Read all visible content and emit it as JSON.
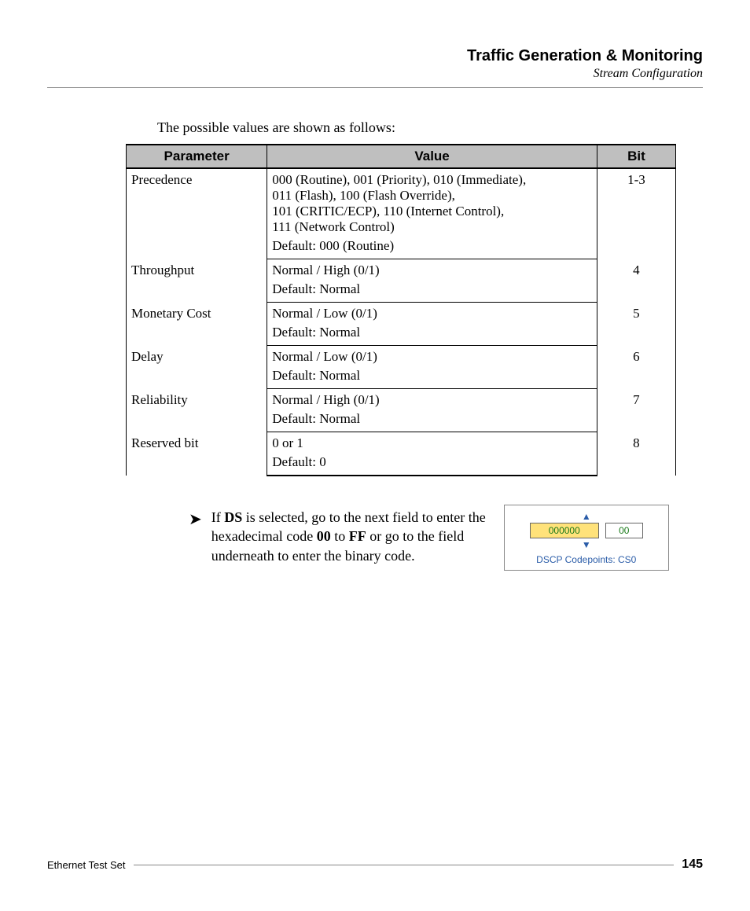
{
  "header": {
    "title": "Traffic Generation & Monitoring",
    "subtitle": "Stream Configuration"
  },
  "intro": "The possible values are shown as follows:",
  "table": {
    "headers": {
      "parameter": "Parameter",
      "value": "Value",
      "bit": "Bit"
    },
    "rows": [
      {
        "parameter": "Precedence",
        "value_lines": [
          "000 (Routine), 001 (Priority), 010 (Immediate),",
          "011 (Flash), 100 (Flash Override),",
          "101 (CRITIC/ECP), 110 (Internet Control),",
          "111 (Network Control)"
        ],
        "default": "Default: 000 (Routine)",
        "bit": "1-3"
      },
      {
        "parameter": "Throughput",
        "value_lines": [
          "Normal / High (0/1)"
        ],
        "default": "Default: Normal",
        "bit": "4"
      },
      {
        "parameter": "Monetary Cost",
        "value_lines": [
          "Normal / Low (0/1)"
        ],
        "default": "Default: Normal",
        "bit": "5"
      },
      {
        "parameter": "Delay",
        "value_lines": [
          "Normal / Low (0/1)"
        ],
        "default": "Default: Normal",
        "bit": "6"
      },
      {
        "parameter": "Reliability",
        "value_lines": [
          "Normal / High (0/1)"
        ],
        "default": "Default: Normal",
        "bit": "7"
      },
      {
        "parameter": "Reserved bit",
        "value_lines": [
          "0 or 1"
        ],
        "default": "Default: 0",
        "bit": "8"
      }
    ]
  },
  "bullet": {
    "pre": "If ",
    "bold1": "DS",
    "mid1": " is selected, go to the next field to enter the hexadecimal code ",
    "bold2": "00",
    "mid2": " to ",
    "bold3": "FF",
    "post": " or go to the field underneath to enter the binary code."
  },
  "widget": {
    "main": "000000",
    "side": "00",
    "caption": "DSCP Codepoints: CS0"
  },
  "footer": {
    "left": "Ethernet Test Set",
    "right": "145"
  }
}
